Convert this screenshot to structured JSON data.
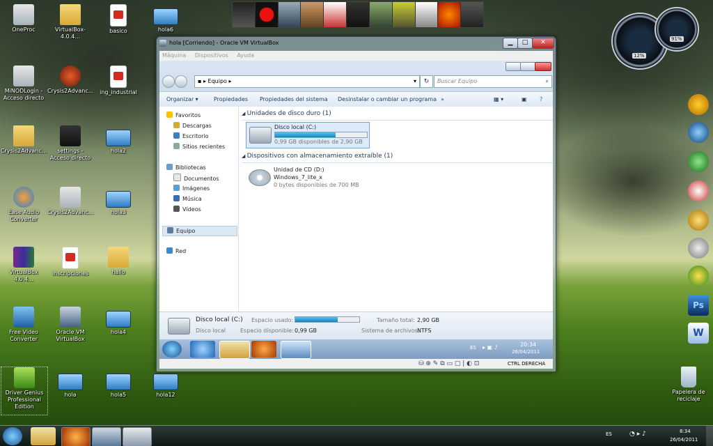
{
  "desktop": {
    "icons": [
      {
        "label": "OneProc"
      },
      {
        "label": "VirtualBox-4.0.4..."
      },
      {
        "label": "basico"
      },
      {
        "label": "hola6"
      },
      {
        "label": "MiNODLogin - Acceso directo"
      },
      {
        "label": "Crysis2Advanc..."
      },
      {
        "label": "ing_industrial"
      },
      {
        "label": "Crysis2Advanc..."
      },
      {
        "label": "settings - Acceso directo"
      },
      {
        "label": "hola2"
      },
      {
        "label": "Ease Audio Converter"
      },
      {
        "label": "Crysis2Advanc..."
      },
      {
        "label": "hola3"
      },
      {
        "label": "VirtualBox 4.0.4..."
      },
      {
        "label": "inscripciones"
      },
      {
        "label": "hallo"
      },
      {
        "label": "Free Video Converter"
      },
      {
        "label": "Oracle VM VirtualBox"
      },
      {
        "label": "hola4"
      },
      {
        "label": "Driver Genius Professional Edition"
      },
      {
        "label": "hola"
      },
      {
        "label": "hola5"
      },
      {
        "label": "hola12"
      },
      {
        "label": "Papelera de reciclaje"
      }
    ],
    "gauges": {
      "cpu": "12%",
      "ram": "91%"
    }
  },
  "vbox": {
    "title": "hola [Corriendo] - Oracle VM VirtualBox",
    "menu": [
      "Máquina",
      "Dispositivos",
      "Ayuda"
    ],
    "status_host_key": "CTRL DERECHA"
  },
  "explorer": {
    "address": "Equipo",
    "search_placeholder": "Buscar Equipo",
    "commands": [
      "Organizar",
      "Propiedades",
      "Propiedades del sistema",
      "Desinstalar o cambiar un programa",
      "»"
    ],
    "nav": {
      "favorites": "Favoritos",
      "fav_items": [
        "Descargas",
        "Escritorio",
        "Sitios recientes"
      ],
      "libraries": "Bibliotecas",
      "lib_items": [
        "Documentos",
        "Imágenes",
        "Música",
        "Vídeos"
      ],
      "computer": "Equipo",
      "network": "Red"
    },
    "groups": {
      "hdd": "Unidades de disco duro (1)",
      "removable": "Dispositivos con almacenamiento extraíble (1)"
    },
    "drive_c": {
      "name": "Disco local (C:)",
      "free": "0,99 GB disponibles de 2,90 GB",
      "used_fraction": 0.66
    },
    "drive_d": {
      "name": "Unidad de CD (D:)",
      "volume": "Windows_7_lite_x",
      "free": "0 bytes disponibles de 700 MB"
    },
    "details": {
      "name": "Disco local (C:)",
      "type": "Disco local",
      "used_label": "Espacio usado:",
      "free_label": "Espacio disponible:",
      "free_value": "0,99 GB",
      "total_label": "Tamaño total:",
      "total_value": "2,90 GB",
      "fs_label": "Sistema de archivos:",
      "fs_value": "NTFS"
    },
    "guest_taskbar": {
      "lang": "ES",
      "time": "20:34",
      "date": "26/04/2011"
    }
  },
  "host_taskbar": {
    "lang": "ES",
    "time": "8:34",
    "date": "26/04/2011"
  }
}
